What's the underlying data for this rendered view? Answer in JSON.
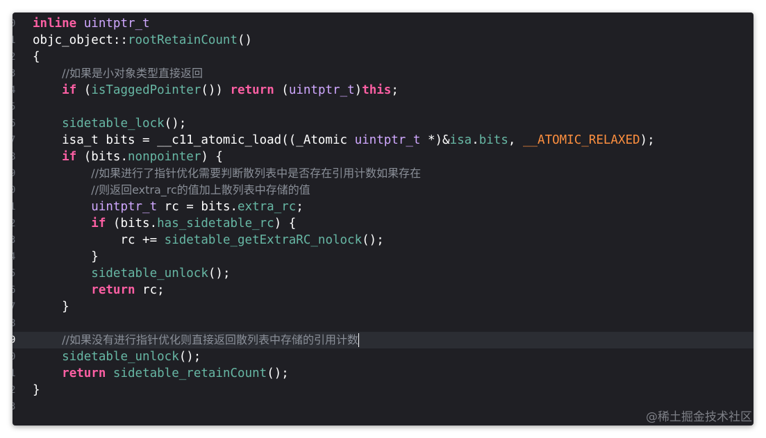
{
  "editor": {
    "lines": [
      {
        "num": "0",
        "tokens": [
          {
            "t": "inline",
            "c": "kw"
          },
          {
            "t": " ",
            "c": "pl"
          },
          {
            "t": "uintptr_t",
            "c": "ty"
          }
        ]
      },
      {
        "num": "1",
        "tokens": [
          {
            "t": "objc_object::",
            "c": "pl"
          },
          {
            "t": "rootRetainCount",
            "c": "fn"
          },
          {
            "t": "()",
            "c": "pl"
          }
        ]
      },
      {
        "num": "2",
        "tokens": [
          {
            "t": "{",
            "c": "pl"
          }
        ]
      },
      {
        "num": "3",
        "tokens": [
          {
            "t": "    ",
            "c": "pl"
          },
          {
            "t": "//如果是小对象类型直接返回",
            "c": "cm"
          }
        ]
      },
      {
        "num": "4",
        "tokens": [
          {
            "t": "    ",
            "c": "pl"
          },
          {
            "t": "if",
            "c": "kw"
          },
          {
            "t": " (",
            "c": "pl"
          },
          {
            "t": "isTaggedPointer",
            "c": "fn"
          },
          {
            "t": "()) ",
            "c": "pl"
          },
          {
            "t": "return",
            "c": "kw"
          },
          {
            "t": " (",
            "c": "pl"
          },
          {
            "t": "uintptr_t",
            "c": "ty"
          },
          {
            "t": ")",
            "c": "pl"
          },
          {
            "t": "this",
            "c": "kw"
          },
          {
            "t": ";",
            "c": "pl"
          }
        ]
      },
      {
        "num": "5",
        "tokens": []
      },
      {
        "num": "6",
        "tokens": [
          {
            "t": "    ",
            "c": "pl"
          },
          {
            "t": "sidetable_lock",
            "c": "fn"
          },
          {
            "t": "();",
            "c": "pl"
          }
        ]
      },
      {
        "num": "7",
        "tokens": [
          {
            "t": "    isa_t bits = __c11_atomic_load((_Atomic ",
            "c": "pl"
          },
          {
            "t": "uintptr_t",
            "c": "ty"
          },
          {
            "t": " *)&",
            "c": "pl"
          },
          {
            "t": "isa",
            "c": "fn"
          },
          {
            "t": ".",
            "c": "pl"
          },
          {
            "t": "bits",
            "c": "fn"
          },
          {
            "t": ", ",
            "c": "pl"
          },
          {
            "t": "__ATOMIC_RELAXED",
            "c": "mc"
          },
          {
            "t": ");",
            "c": "pl"
          }
        ]
      },
      {
        "num": "8",
        "tokens": [
          {
            "t": "    ",
            "c": "pl"
          },
          {
            "t": "if",
            "c": "kw"
          },
          {
            "t": " (bits.",
            "c": "pl"
          },
          {
            "t": "nonpointer",
            "c": "fn"
          },
          {
            "t": ") {",
            "c": "pl"
          }
        ]
      },
      {
        "num": "9",
        "tokens": [
          {
            "t": "        ",
            "c": "pl"
          },
          {
            "t": "//如果进行了指针优化需要判断散列表中是否存在引用计数如果存在",
            "c": "cm"
          }
        ]
      },
      {
        "num": "0",
        "tokens": [
          {
            "t": "        ",
            "c": "pl"
          },
          {
            "t": "//则返回extra_rc的值加上散列表中存储的值",
            "c": "cm"
          }
        ]
      },
      {
        "num": "1",
        "tokens": [
          {
            "t": "        ",
            "c": "pl"
          },
          {
            "t": "uintptr_t",
            "c": "ty"
          },
          {
            "t": " rc = bits.",
            "c": "pl"
          },
          {
            "t": "extra_rc",
            "c": "fn"
          },
          {
            "t": ";",
            "c": "pl"
          }
        ]
      },
      {
        "num": "2",
        "tokens": [
          {
            "t": "        ",
            "c": "pl"
          },
          {
            "t": "if",
            "c": "kw"
          },
          {
            "t": " (bits.",
            "c": "pl"
          },
          {
            "t": "has_sidetable_rc",
            "c": "fn"
          },
          {
            "t": ") {",
            "c": "pl"
          }
        ]
      },
      {
        "num": "3",
        "tokens": [
          {
            "t": "            rc += ",
            "c": "pl"
          },
          {
            "t": "sidetable_getExtraRC_nolock",
            "c": "fn"
          },
          {
            "t": "();",
            "c": "pl"
          }
        ]
      },
      {
        "num": "4",
        "tokens": [
          {
            "t": "        }",
            "c": "pl"
          }
        ]
      },
      {
        "num": "5",
        "tokens": [
          {
            "t": "        ",
            "c": "pl"
          },
          {
            "t": "sidetable_unlock",
            "c": "fn"
          },
          {
            "t": "();",
            "c": "pl"
          }
        ]
      },
      {
        "num": "6",
        "tokens": [
          {
            "t": "        ",
            "c": "pl"
          },
          {
            "t": "return",
            "c": "kw"
          },
          {
            "t": " rc;",
            "c": "pl"
          }
        ]
      },
      {
        "num": "7",
        "tokens": [
          {
            "t": "    }",
            "c": "pl"
          }
        ]
      },
      {
        "num": "8",
        "tokens": []
      },
      {
        "num": "9",
        "current": true,
        "tokens": [
          {
            "t": "    ",
            "c": "pl"
          },
          {
            "t": "//如果没有进行指针优化则直接返回散列表中存储的引用计数",
            "c": "cm"
          }
        ]
      },
      {
        "num": "0",
        "tokens": [
          {
            "t": "    ",
            "c": "pl"
          },
          {
            "t": "sidetable_unlock",
            "c": "fn"
          },
          {
            "t": "();",
            "c": "pl"
          }
        ]
      },
      {
        "num": "1",
        "tokens": [
          {
            "t": "    ",
            "c": "pl"
          },
          {
            "t": "return",
            "c": "kw"
          },
          {
            "t": " ",
            "c": "pl"
          },
          {
            "t": "sidetable_retainCount",
            "c": "fn"
          },
          {
            "t": "();",
            "c": "pl"
          }
        ]
      },
      {
        "num": "2",
        "tokens": [
          {
            "t": "}",
            "c": "pl"
          }
        ]
      },
      {
        "num": "3",
        "tokens": []
      }
    ]
  },
  "watermark": "@稀土掘金技术社区",
  "colors": {
    "background": "#1f1f24",
    "keyword": "#fc5fa3",
    "type": "#d0a8ff",
    "function": "#67b7a4",
    "comment": "#8a8f98",
    "macro": "#fd8f3f",
    "plain": "#ffffff",
    "current_line": "#2b2d33"
  }
}
